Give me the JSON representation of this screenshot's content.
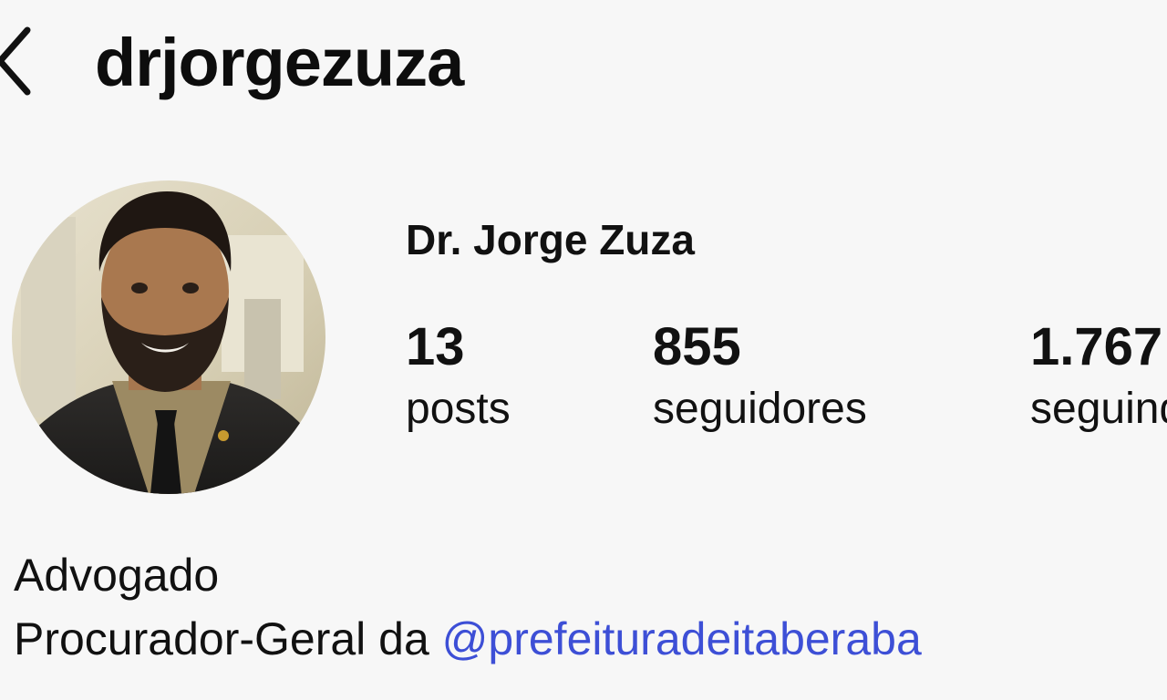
{
  "header": {
    "username": "drjorgezuza",
    "back_icon": "chevron-left-icon"
  },
  "profile": {
    "display_name": "Dr. Jorge Zuza",
    "avatar_alt": "profile photo"
  },
  "stats": [
    {
      "value": "13",
      "label": "posts"
    },
    {
      "value": "855",
      "label": "seguidores"
    },
    {
      "value": "1.767",
      "label": "seguindo"
    }
  ],
  "bio": {
    "line1": "Advogado",
    "line2_prefix": "Procurador-Geral da ",
    "mention": "@prefeituradeitaberaba"
  },
  "colors": {
    "background": "#f7f7f7",
    "text": "#111111",
    "mention": "#3d4fd6"
  }
}
